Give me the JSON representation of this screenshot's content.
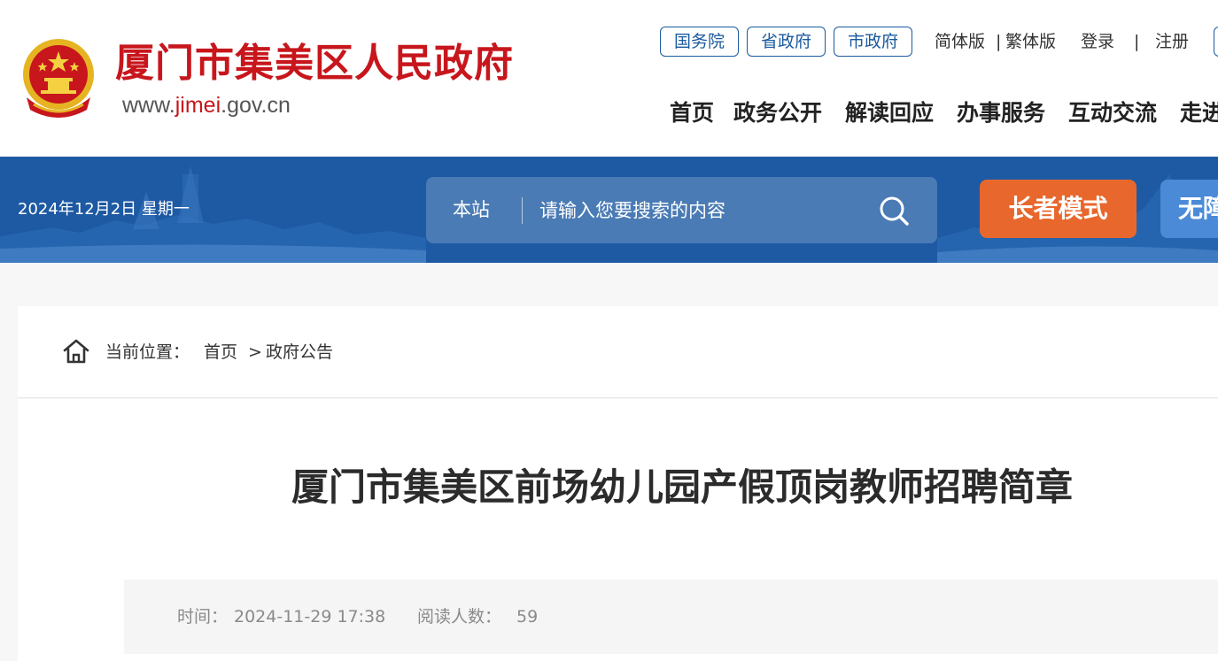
{
  "header": {
    "site_name": "厦门市集美区人民政府",
    "url_prefix": "www.",
    "url_highlight": "jimei",
    "url_suffix": ".gov.cn",
    "gov_links": [
      "国务院",
      "省政府",
      "市政府"
    ],
    "lang_simplified": "简体版",
    "lang_sep": "|",
    "lang_traditional": "繁体版",
    "login": "登录",
    "auth_sep": "|",
    "register": "注册",
    "nav": [
      "首页",
      "政务公开",
      "解读回应",
      "办事服务",
      "互动交流",
      "走进集美"
    ],
    "brand_color": "#c8161d"
  },
  "banner": {
    "date": "2024年12月2日 星期一",
    "search_scope": "本站",
    "search_placeholder": "请输入您要搜索的内容",
    "elder_mode": "长者模式",
    "barrier_free": "无障碍",
    "bg_color": "#1d5aa3",
    "elder_color": "#e8672c"
  },
  "breadcrumb": {
    "label": "当前位置：",
    "home": "首页",
    "sep": ">",
    "current": "政府公告"
  },
  "article": {
    "title": "厦门市集美区前场幼儿园产假顶岗教师招聘简章",
    "time_label": "时间：",
    "time_value": "2024-11-29 17:38",
    "views_label": "阅读人数：",
    "views_value": "59"
  }
}
